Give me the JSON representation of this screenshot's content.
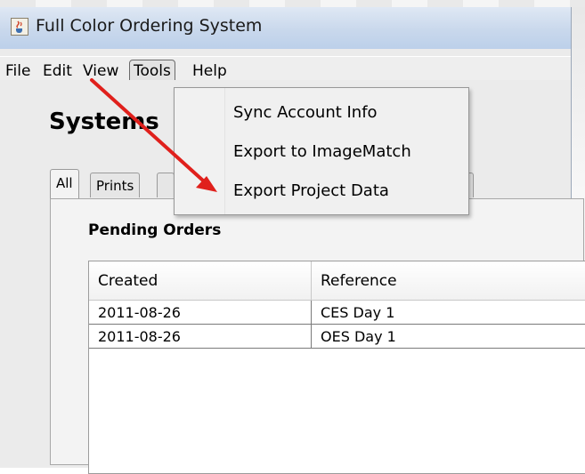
{
  "window": {
    "title": "Full Color Ordering System",
    "icon": "java-cup-icon"
  },
  "menubar": {
    "items": [
      {
        "label": "File"
      },
      {
        "label": "Edit"
      },
      {
        "label": "View"
      },
      {
        "label": "Tools",
        "active": true
      },
      {
        "label": "Help"
      }
    ]
  },
  "tools_menu": {
    "items": [
      {
        "label": "Sync Account Info"
      },
      {
        "label": "Export to ImageMatch"
      },
      {
        "label": "Export Project Data"
      }
    ]
  },
  "main": {
    "heading": "Systems",
    "tabs": [
      {
        "label": "All",
        "selected": true
      },
      {
        "label": "Prints"
      }
    ],
    "section_title": "Pending Orders",
    "table": {
      "columns": [
        "Created",
        "Reference"
      ],
      "rows": [
        [
          "2011-08-26",
          "CES Day 1"
        ],
        [
          "2011-08-26",
          "OES Day 1"
        ]
      ]
    }
  },
  "annotation": {
    "arrow_color": "#e0201c"
  },
  "colors": {
    "titlebar": "#c9d8ec",
    "menu_bg": "#eeeeee",
    "window_bg": "#ebebeb"
  }
}
